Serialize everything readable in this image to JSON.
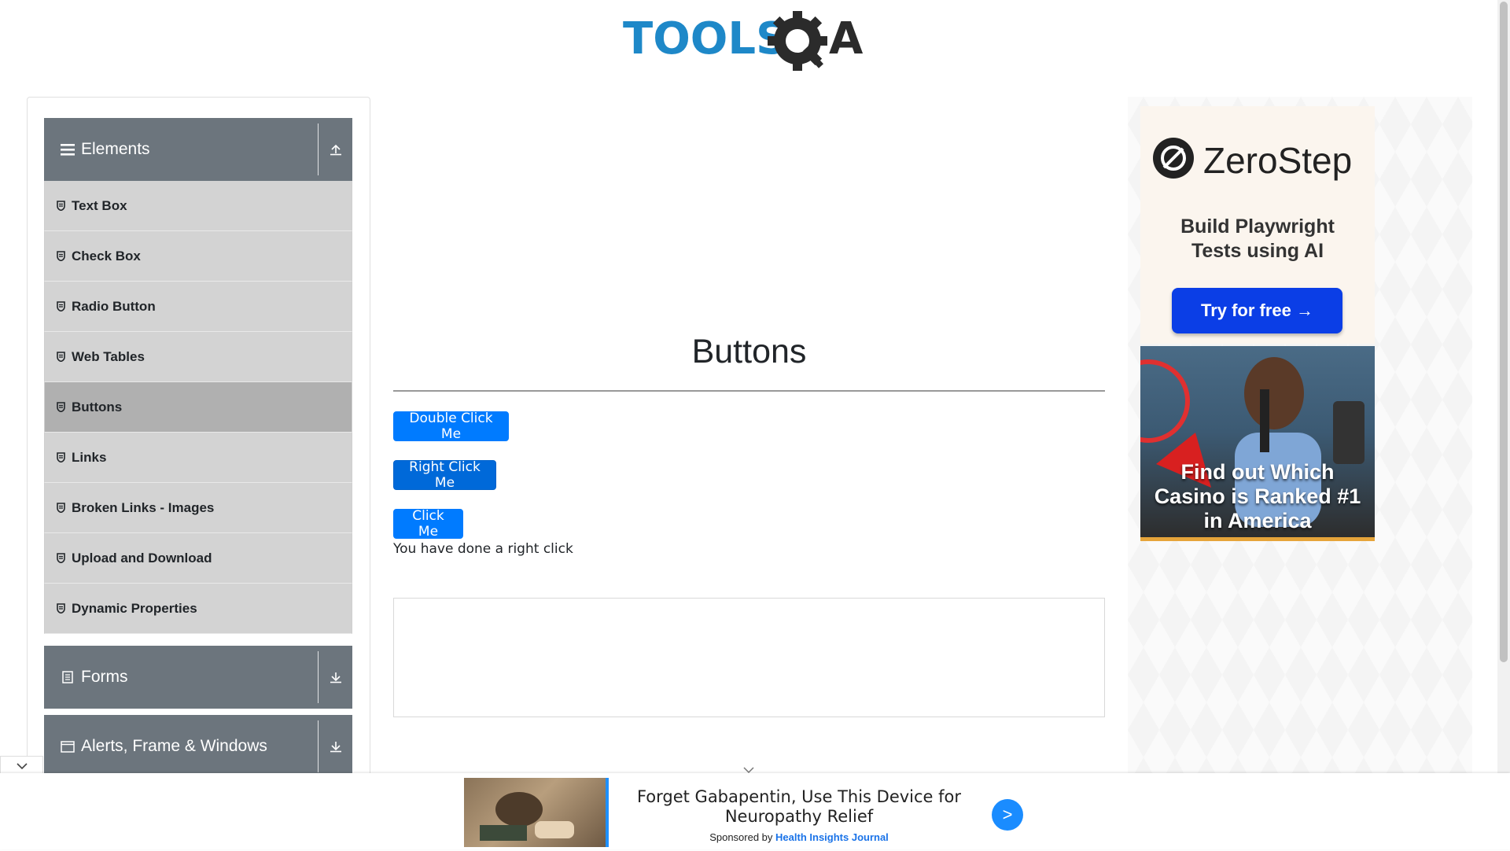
{
  "logo": {
    "text_tools": "TOOLS",
    "text_qa": "QA"
  },
  "sidebar": {
    "elements": {
      "label": "Elements",
      "state": "expanded"
    },
    "items": [
      {
        "label": "Text Box"
      },
      {
        "label": "Check Box"
      },
      {
        "label": "Radio Button"
      },
      {
        "label": "Web Tables"
      },
      {
        "label": "Buttons",
        "active": true
      },
      {
        "label": "Links"
      },
      {
        "label": "Broken Links - Images"
      },
      {
        "label": "Upload and Download"
      },
      {
        "label": "Dynamic Properties"
      }
    ],
    "forms": {
      "label": "Forms"
    },
    "alerts": {
      "label": "Alerts, Frame & Windows"
    }
  },
  "main": {
    "title": "Buttons",
    "double_click_label": "Double Click Me",
    "right_click_label": "Right Click Me",
    "click_label": "Click Me",
    "message": "You have done a right click"
  },
  "right_ad": {
    "brand": "ZeroStep",
    "tagline_1": "Build Playwright",
    "tagline_2": "Tests using AI",
    "cta": "Try for free →",
    "casino_line_1": "Find out Which",
    "casino_line_2": "Casino is Ranked #1",
    "casino_line_3": "in America"
  },
  "bottom_ad": {
    "headline_1": "Forget Gabapentin, Use This Device for",
    "headline_2": "Neuropathy Relief",
    "sponsored_prefix": "Sponsored by",
    "sponsor": "Health Insights Journal",
    "go_label": ">"
  },
  "colors": {
    "primary_button": "#007bff",
    "sidebar_header": "#6c757d",
    "menu_item": "#d3d3d3",
    "menu_item_active": "#b0b0b0",
    "logo_blue": "#1e88c8",
    "logo_dark": "#2b2b2b"
  },
  "icons": {
    "menu": "hamburger-icon",
    "collapse": "arrow-up-icon",
    "expand": "arrow-down-icon",
    "item": "shield-icon",
    "forms": "document-icon",
    "alerts": "window-icon"
  }
}
